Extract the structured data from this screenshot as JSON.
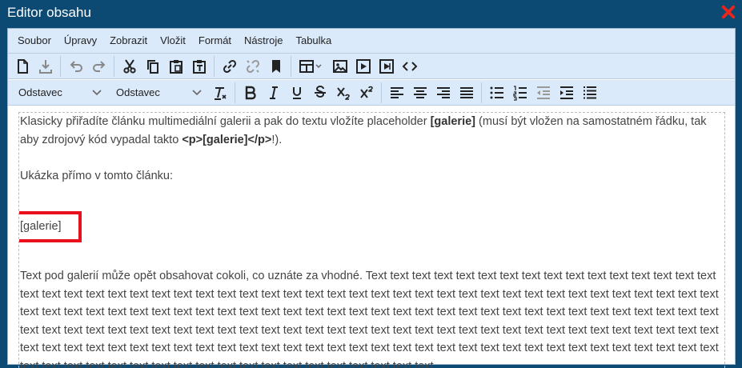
{
  "window": {
    "title": "Editor obsahu",
    "close_icon": "close-icon",
    "accent_close": "#e8261c",
    "background": "#0d4a73"
  },
  "menubar": {
    "items": [
      "Soubor",
      "Úpravy",
      "Zobrazit",
      "Vložit",
      "Formát",
      "Nástroje",
      "Tabulka"
    ]
  },
  "toolbar1": {
    "icons": [
      "new-document-icon",
      "download-icon",
      "undo-icon",
      "redo-icon",
      "cut-icon",
      "copy-icon",
      "paste-icon",
      "paste-text-icon",
      "link-icon",
      "unlink-icon",
      "bookmark-icon",
      "table-icon",
      "image-icon",
      "media-icon",
      "video-icon",
      "code-icon"
    ]
  },
  "toolbar2": {
    "select1": "Odstavec",
    "select2": "Odstavec",
    "icons": [
      "clear-formatting-icon",
      "bold-icon",
      "italic-icon",
      "underline-icon",
      "strikethrough-icon",
      "subscript-icon",
      "superscript-icon",
      "align-left-icon",
      "align-center-icon",
      "align-right-icon",
      "justify-icon",
      "bullet-list-icon",
      "numbered-list-icon",
      "outdent-icon",
      "indent-icon",
      "line-height-icon"
    ]
  },
  "content": {
    "p1_a": "Klasicky přiřadíte článku multimediální galerii a pak do textu vložíte placeholder ",
    "p1_b": "[galerie]",
    "p1_c": " (musí být vložen na samostatném řádku, tak aby zdrojový kód vypadal takto ",
    "p1_d": "<p>[galerie]</p>",
    "p1_e": "!).",
    "p2": "Ukázka přímo v tomto článku:",
    "p3": "[galerie]",
    "p4": "Text pod galerií může opět obsahovat cokoli, co uznáte za vhodné. Text text text text text text text text text text text text text text text text text text text text text text text text text text text text text text text text text text text text text text text text text text text text text text text text text text text text text text text text text text text text text text text text text text text text text text text text text text text text text text text text text text text text text text text text text text text text text text text text text text text text text text text text text text text text text text text text text text text text text text text text text text text text text text text text text text text text text text text text text text text text text text text text text text text text text text text text text text text text text text text text text text text."
  }
}
